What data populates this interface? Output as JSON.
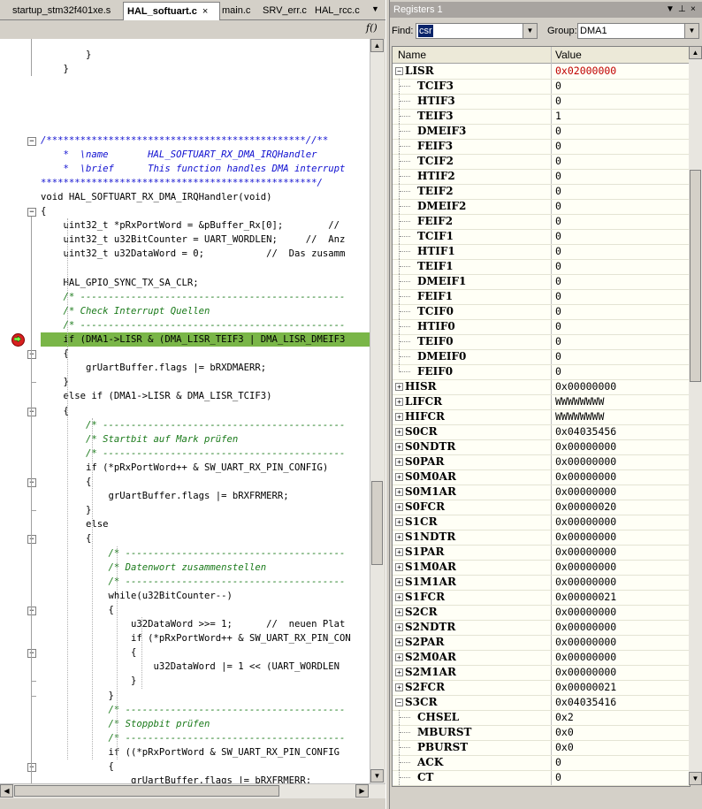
{
  "editor": {
    "tabs": [
      {
        "label": "startup_stm32f401xe.s",
        "active": false
      },
      {
        "label": "HAL_softuart.c",
        "active": true
      },
      {
        "label": "main.c",
        "active": false
      },
      {
        "label": "SRV_err.c",
        "active": false
      },
      {
        "label": "HAL_rcc.c",
        "active": false
      }
    ],
    "tab_close_glyph": "×",
    "tab_menu_glyph": "▼",
    "function_button": "f()",
    "code_lines": [
      {
        "text": "        }",
        "cls": ""
      },
      {
        "text": "    }",
        "cls": ""
      },
      {
        "text": "",
        "cls": ""
      },
      {
        "text": "",
        "cls": ""
      },
      {
        "text": "",
        "cls": ""
      },
      {
        "text": "",
        "cls": ""
      },
      {
        "text": "/**********************************************//**",
        "cls": "cb"
      },
      {
        "text": "    *  \\name       HAL_SOFTUART_RX_DMA_IRQHandler",
        "cls": "cb"
      },
      {
        "text": "    *  \\brief      This function handles DMA interrupt",
        "cls": "cb"
      },
      {
        "text": "*************************************************/",
        "cls": "cb"
      },
      {
        "text": "void HAL_SOFTUART_RX_DMA_IRQHandler(void)",
        "cls": ""
      },
      {
        "text": "{",
        "cls": ""
      },
      {
        "text": "    uint32_t *pRxPortWord = &pBuffer_Rx[0];        //",
        "cls": ""
      },
      {
        "text": "    uint32_t u32BitCounter = UART_WORDLEN;     //  Anz",
        "cls": ""
      },
      {
        "text": "    uint32_t u32DataWord = 0;           //  Das zusamm",
        "cls": ""
      },
      {
        "text": "",
        "cls": ""
      },
      {
        "text": "    HAL_GPIO_SYNC_TX_SA_CLR;",
        "cls": ""
      },
      {
        "text": "    /* -----------------------------------------------",
        "cls": "cm"
      },
      {
        "text": "    /* Check Interrupt Quellen",
        "cls": "cm"
      },
      {
        "text": "    /* -----------------------------------------------",
        "cls": "cm"
      },
      {
        "text": "    if (DMA1->LISR & (DMA_LISR_TEIF3 | DMA_LISR_DMEIF3",
        "cls": "hl"
      },
      {
        "text": "    {",
        "cls": ""
      },
      {
        "text": "        grUartBuffer.flags |= bRXDMAERR;",
        "cls": ""
      },
      {
        "text": "    }",
        "cls": ""
      },
      {
        "text": "    else if (DMA1->LISR & DMA_LISR_TCIF3)",
        "cls": ""
      },
      {
        "text": "    {",
        "cls": ""
      },
      {
        "text": "        /* -------------------------------------------",
        "cls": "cm"
      },
      {
        "text": "        /* Startbit auf Mark prüfen",
        "cls": "cm"
      },
      {
        "text": "        /* -------------------------------------------",
        "cls": "cm"
      },
      {
        "text": "        if (*pRxPortWord++ & SW_UART_RX_PIN_CONFIG)",
        "cls": ""
      },
      {
        "text": "        {",
        "cls": ""
      },
      {
        "text": "            grUartBuffer.flags |= bRXFRMERR;",
        "cls": ""
      },
      {
        "text": "        }",
        "cls": ""
      },
      {
        "text": "        else",
        "cls": ""
      },
      {
        "text": "        {",
        "cls": ""
      },
      {
        "text": "            /* ---------------------------------------",
        "cls": "cm"
      },
      {
        "text": "            /* Datenwort zusammenstellen",
        "cls": "cm"
      },
      {
        "text": "            /* ---------------------------------------",
        "cls": "cm"
      },
      {
        "text": "            while(u32BitCounter--)",
        "cls": ""
      },
      {
        "text": "            {",
        "cls": ""
      },
      {
        "text": "                u32DataWord >>= 1;      //  neuen Plat",
        "cls": ""
      },
      {
        "text": "                if (*pRxPortWord++ & SW_UART_RX_PIN_CON",
        "cls": ""
      },
      {
        "text": "                {",
        "cls": ""
      },
      {
        "text": "                    u32DataWord |= 1 << (UART_WORDLEN",
        "cls": ""
      },
      {
        "text": "                }",
        "cls": ""
      },
      {
        "text": "            }",
        "cls": ""
      },
      {
        "text": "            /* ---------------------------------------",
        "cls": "cm"
      },
      {
        "text": "            /* Stoppbit prüfen",
        "cls": "cm"
      },
      {
        "text": "            /* ---------------------------------------",
        "cls": "cm"
      },
      {
        "text": "            if ((*pRxPortWord & SW_UART_RX_PIN_CONFIG",
        "cls": ""
      },
      {
        "text": "            {",
        "cls": ""
      },
      {
        "text": "                grUartBuffer.flags |= bRXFRMERR;",
        "cls": ""
      }
    ]
  },
  "registers": {
    "title": "Registers 1",
    "title_buttons": [
      "▼",
      "⊥",
      "×"
    ],
    "find_label": "Find:",
    "find_value": "csr",
    "group_label": "Group:",
    "group_value": "DMA1",
    "col_name": "Name",
    "col_value": "Value",
    "rows": [
      {
        "name": "LISR",
        "value": "0x02000000",
        "level": 0,
        "exp": "−",
        "red": true
      },
      {
        "name": "TCIF3",
        "value": "0",
        "level": 1
      },
      {
        "name": "HTIF3",
        "value": "0",
        "level": 1
      },
      {
        "name": "TEIF3",
        "value": "1",
        "level": 1
      },
      {
        "name": "DMEIF3",
        "value": "0",
        "level": 1
      },
      {
        "name": "FEIF3",
        "value": "0",
        "level": 1
      },
      {
        "name": "TCIF2",
        "value": "0",
        "level": 1
      },
      {
        "name": "HTIF2",
        "value": "0",
        "level": 1
      },
      {
        "name": "TEIF2",
        "value": "0",
        "level": 1
      },
      {
        "name": "DMEIF2",
        "value": "0",
        "level": 1
      },
      {
        "name": "FEIF2",
        "value": "0",
        "level": 1
      },
      {
        "name": "TCIF1",
        "value": "0",
        "level": 1
      },
      {
        "name": "HTIF1",
        "value": "0",
        "level": 1
      },
      {
        "name": "TEIF1",
        "value": "0",
        "level": 1
      },
      {
        "name": "DMEIF1",
        "value": "0",
        "level": 1
      },
      {
        "name": "FEIF1",
        "value": "0",
        "level": 1
      },
      {
        "name": "TCIF0",
        "value": "0",
        "level": 1
      },
      {
        "name": "HTIF0",
        "value": "0",
        "level": 1
      },
      {
        "name": "TEIF0",
        "value": "0",
        "level": 1
      },
      {
        "name": "DMEIF0",
        "value": "0",
        "level": 1
      },
      {
        "name": "FEIF0",
        "value": "0",
        "level": 1,
        "last": true
      },
      {
        "name": "HISR",
        "value": "0x00000000",
        "level": 0,
        "exp": "+"
      },
      {
        "name": "LIFCR",
        "value": "WWWWWWWW",
        "level": 0,
        "exp": "+"
      },
      {
        "name": "HIFCR",
        "value": "WWWWWWWW",
        "level": 0,
        "exp": "+"
      },
      {
        "name": "S0CR",
        "value": "0x04035456",
        "level": 0,
        "exp": "+"
      },
      {
        "name": "S0NDTR",
        "value": "0x00000000",
        "level": 0,
        "exp": "+"
      },
      {
        "name": "S0PAR",
        "value": "0x00000000",
        "level": 0,
        "exp": "+"
      },
      {
        "name": "S0M0AR",
        "value": "0x00000000",
        "level": 0,
        "exp": "+"
      },
      {
        "name": "S0M1AR",
        "value": "0x00000000",
        "level": 0,
        "exp": "+"
      },
      {
        "name": "S0FCR",
        "value": "0x00000020",
        "level": 0,
        "exp": "+"
      },
      {
        "name": "S1CR",
        "value": "0x00000000",
        "level": 0,
        "exp": "+"
      },
      {
        "name": "S1NDTR",
        "value": "0x00000000",
        "level": 0,
        "exp": "+"
      },
      {
        "name": "S1PAR",
        "value": "0x00000000",
        "level": 0,
        "exp": "+"
      },
      {
        "name": "S1M0AR",
        "value": "0x00000000",
        "level": 0,
        "exp": "+"
      },
      {
        "name": "S1M1AR",
        "value": "0x00000000",
        "level": 0,
        "exp": "+"
      },
      {
        "name": "S1FCR",
        "value": "0x00000021",
        "level": 0,
        "exp": "+"
      },
      {
        "name": "S2CR",
        "value": "0x00000000",
        "level": 0,
        "exp": "+"
      },
      {
        "name": "S2NDTR",
        "value": "0x00000000",
        "level": 0,
        "exp": "+"
      },
      {
        "name": "S2PAR",
        "value": "0x00000000",
        "level": 0,
        "exp": "+"
      },
      {
        "name": "S2M0AR",
        "value": "0x00000000",
        "level": 0,
        "exp": "+"
      },
      {
        "name": "S2M1AR",
        "value": "0x00000000",
        "level": 0,
        "exp": "+"
      },
      {
        "name": "S2FCR",
        "value": "0x00000021",
        "level": 0,
        "exp": "+"
      },
      {
        "name": "S3CR",
        "value": "0x04035416",
        "level": 0,
        "exp": "−"
      },
      {
        "name": "CHSEL",
        "value": "0x2",
        "level": 1
      },
      {
        "name": "MBURST",
        "value": "0x0",
        "level": 1
      },
      {
        "name": "PBURST",
        "value": "0x0",
        "level": 1
      },
      {
        "name": "ACK",
        "value": "0",
        "level": 1
      },
      {
        "name": "CT",
        "value": "0",
        "level": 1
      }
    ]
  },
  "colors": {
    "highlight": "#7ab648",
    "comment": "#1a7a1a",
    "doc_comment": "#1010d0",
    "changed_value": "#c00000"
  }
}
